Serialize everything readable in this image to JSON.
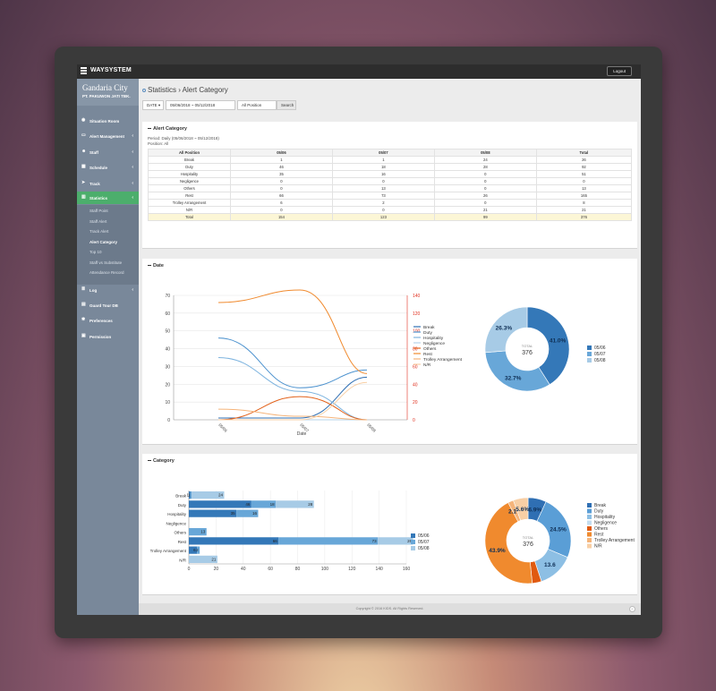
{
  "app": {
    "brand": "WAYSYSTEM",
    "logout": "Logout"
  },
  "logo": {
    "name": "Gandaria City",
    "sub": "PT. PAKUWON JATI TBK."
  },
  "sidebar": {
    "items": [
      {
        "label": "Situation Room",
        "icon": "dashboard-icon",
        "chev": ""
      },
      {
        "label": "Alert Management",
        "icon": "monitor-icon",
        "chev": "‹"
      },
      {
        "label": "Staff",
        "icon": "users-icon",
        "chev": "‹"
      },
      {
        "label": "Schedule",
        "icon": "calendar-icon",
        "chev": "‹"
      },
      {
        "label": "Track",
        "icon": "track-icon",
        "chev": "‹"
      },
      {
        "label": "Statistics",
        "icon": "bar-chart-icon",
        "chev": "‹"
      }
    ],
    "submenu": [
      "Staff Point",
      "Staff Alert",
      "Track Alert",
      "Alert Category",
      "Top 10",
      "Staff vs Substitute",
      "Attendance Record"
    ],
    "items2": [
      {
        "label": "Log",
        "icon": "log-icon",
        "chev": "‹"
      },
      {
        "label": "Guard Tour DB",
        "icon": "database-icon",
        "chev": ""
      },
      {
        "label": "Preferences",
        "icon": "gear-icon",
        "chev": ""
      },
      {
        "label": "Permission",
        "icon": "lock-icon",
        "chev": ""
      }
    ]
  },
  "page": {
    "title": "Statistics › Alert Category",
    "filters": {
      "type": "DATE ▾",
      "range": "05/06/2018 ~ 05/12/2018",
      "position": "All Position",
      "search": "Search"
    }
  },
  "alert_panel": {
    "title": "Alert Category",
    "period": "Period: Daily (05/06/2018 ~ 05/12/2018)",
    "position": "Position: All",
    "headers": [
      "All Position",
      "05/06",
      "05/07",
      "05/08",
      "Total"
    ],
    "rows": [
      [
        "Break",
        "1",
        "1",
        "24",
        "26"
      ],
      [
        "Duty",
        "46",
        "18",
        "28",
        "92"
      ],
      [
        "Hospitality",
        "35",
        "16",
        "0",
        "51"
      ],
      [
        "Negligence",
        "0",
        "0",
        "0",
        "0"
      ],
      [
        "Others",
        "0",
        "13",
        "0",
        "13"
      ],
      [
        "Rest",
        "66",
        "73",
        "26",
        "165"
      ],
      [
        "Trolley Arrangement",
        "6",
        "2",
        "0",
        "8"
      ],
      [
        "N/R",
        "0",
        "0",
        "21",
        "21"
      ],
      [
        "Total",
        "154",
        "123",
        "99",
        "376"
      ]
    ]
  },
  "date_panel": {
    "title": "Date",
    "legend": [
      "Break",
      "Duty",
      "Hospitality",
      "Negligence",
      "Others",
      "Rest",
      "Trolley Arrangement",
      "N/R"
    ],
    "donut_total_label": "TOTAL",
    "donut_total": "376",
    "donut_legend": [
      "05/06",
      "05/07",
      "05/08"
    ]
  },
  "category_panel": {
    "title": "Category",
    "donut_total_label": "TOTAL",
    "donut_total": "376"
  },
  "footer": {
    "text": "Copyright © 2016 KIDS. All Rights Reserved.",
    "up": "^"
  },
  "colors": {
    "sidebar": "#79889a",
    "active": "#4cae6c",
    "dark_blue": "#3478b8",
    "mid_blue": "#68a7d8",
    "light_blue": "#a7cbe6",
    "orange": "#f08a2e",
    "dark_orange": "#e05a10",
    "peach": "#f7b97c"
  },
  "chart_data": [
    {
      "type": "line",
      "title": "",
      "xlabel": "Date",
      "ylabel": "",
      "x": [
        "05/06",
        "05/07",
        "05/08"
      ],
      "ylim": [
        0,
        70
      ],
      "y2lim": [
        0,
        140
      ],
      "series": [
        {
          "name": "Break",
          "values": [
            1,
            1,
            24
          ]
        },
        {
          "name": "Duty",
          "values": [
            46,
            18,
            28
          ]
        },
        {
          "name": "Hospitality",
          "values": [
            35,
            16,
            0
          ]
        },
        {
          "name": "Negligence",
          "values": [
            0,
            0,
            0
          ]
        },
        {
          "name": "Others",
          "values": [
            0,
            13,
            0
          ]
        },
        {
          "name": "Rest",
          "values": [
            66,
            73,
            26
          ]
        },
        {
          "name": "Trolley Arrangement",
          "values": [
            6,
            2,
            0
          ]
        },
        {
          "name": "N/R",
          "values": [
            0,
            0,
            21
          ]
        }
      ],
      "yticks": [
        0,
        10,
        20,
        30,
        40,
        50,
        60,
        70
      ],
      "y2ticks": [
        0,
        20,
        40,
        60,
        80,
        100,
        120,
        140
      ],
      "legend": "right",
      "grid": true
    },
    {
      "type": "pie",
      "categories": [
        "05/06",
        "05/07",
        "05/08"
      ],
      "values": [
        41.0,
        32.7,
        26.3
      ],
      "labels": [
        "41.0%",
        "32.7%",
        "26.3%"
      ],
      "total": 376,
      "legend": "right"
    },
    {
      "type": "bar",
      "orientation": "horizontal",
      "stacked": true,
      "categories": [
        "Break",
        "Duty",
        "Hospitality",
        "Negligence",
        "Others",
        "Rest",
        "Trolley Arrangement",
        "N/R"
      ],
      "series": [
        {
          "name": "05/06",
          "values": [
            1,
            46,
            35,
            0,
            0,
            66,
            6,
            0
          ]
        },
        {
          "name": "05/07",
          "values": [
            1,
            18,
            16,
            0,
            13,
            73,
            2,
            0
          ]
        },
        {
          "name": "05/08",
          "values": [
            24,
            28,
            0,
            0,
            0,
            26,
            0,
            21
          ]
        }
      ],
      "bar_labels": [
        [
          "1",
          "1",
          "24"
        ],
        [
          "46",
          "18",
          "28"
        ],
        [
          "35",
          "16",
          ""
        ],
        [
          "",
          "",
          ""
        ],
        [
          "",
          "13",
          ""
        ],
        [
          "66",
          "73",
          "26"
        ],
        [
          "6",
          "2",
          ""
        ],
        [
          "",
          "",
          "21"
        ]
      ],
      "xticks": [
        0,
        20,
        40,
        60,
        80,
        100,
        120,
        140,
        160
      ],
      "xlim": [
        0,
        160
      ],
      "legend": "right",
      "grid": true
    },
    {
      "type": "pie",
      "categories": [
        "Break",
        "Duty",
        "Hospitality",
        "Negligence",
        "Others",
        "Rest",
        "Trolley Arrangement",
        "N/R"
      ],
      "values": [
        6.9,
        24.5,
        13.6,
        0,
        3.5,
        43.9,
        2.1,
        5.6
      ],
      "labels": [
        "6.9%",
        "24.5%",
        "13.6",
        "",
        "",
        "43.9%",
        "2.1%",
        "5.6%"
      ],
      "total": 376,
      "legend": "right"
    }
  ]
}
